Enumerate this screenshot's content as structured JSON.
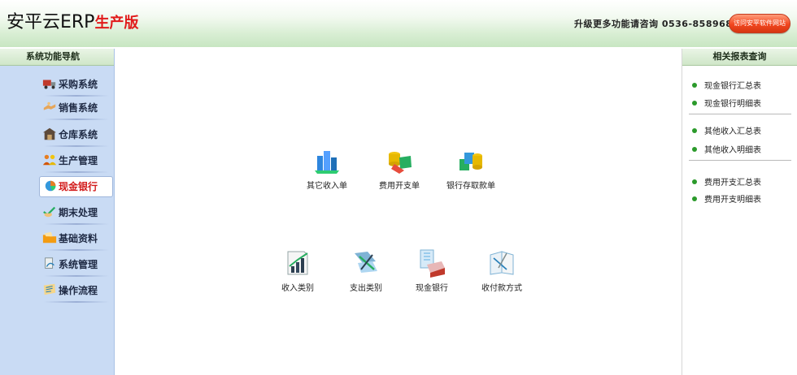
{
  "header": {
    "logo_main": "安平云ERP",
    "logo_edition": "生产版",
    "upgrade_text": "升级更多功能请咨询 0536-8589685",
    "visit_button": "访问安平软件网站"
  },
  "left_nav": {
    "title": "系统功能导航",
    "items": [
      {
        "label": "采购系统",
        "icon": "truck-icon"
      },
      {
        "label": "销售系统",
        "icon": "handshake-icon"
      },
      {
        "label": "仓库系统",
        "icon": "warehouse-icon"
      },
      {
        "label": "生产管理",
        "icon": "people-icon"
      },
      {
        "label": "现金银行",
        "icon": "coin-pie-icon",
        "active": true
      },
      {
        "label": "期末处理",
        "icon": "hand-check-icon"
      },
      {
        "label": "基础资料",
        "icon": "folder-icon"
      },
      {
        "label": "系统管理",
        "icon": "user-gear-icon"
      },
      {
        "label": "操作流程",
        "icon": "flow-book-icon"
      }
    ]
  },
  "center": {
    "row1": [
      {
        "label": "其它收入单",
        "icon": "city-income-icon"
      },
      {
        "label": "费用开支单",
        "icon": "expense-coins-icon"
      },
      {
        "label": "银行存取款单",
        "icon": "bank-deposit-icon"
      }
    ],
    "row2": [
      {
        "label": "收入类别",
        "icon": "growth-chart-icon"
      },
      {
        "label": "支出类别",
        "icon": "expense-tools-icon"
      },
      {
        "label": "现金银行",
        "icon": "cash-box-icon"
      },
      {
        "label": "收付款方式",
        "icon": "payment-book-icon"
      }
    ]
  },
  "right_panel": {
    "title": "相关报表查询",
    "groups": [
      [
        "现金银行汇总表",
        "现金银行明细表"
      ],
      [
        "其他收入汇总表",
        "其他收入明细表"
      ],
      [
        "费用开支汇总表",
        "费用开支明细表"
      ]
    ]
  },
  "colors": {
    "edition_red": "#e11b1b",
    "nav_bg": "#c9dbf4",
    "bullet_green": "#2b9a2b",
    "button_orange": "#f2471f"
  }
}
